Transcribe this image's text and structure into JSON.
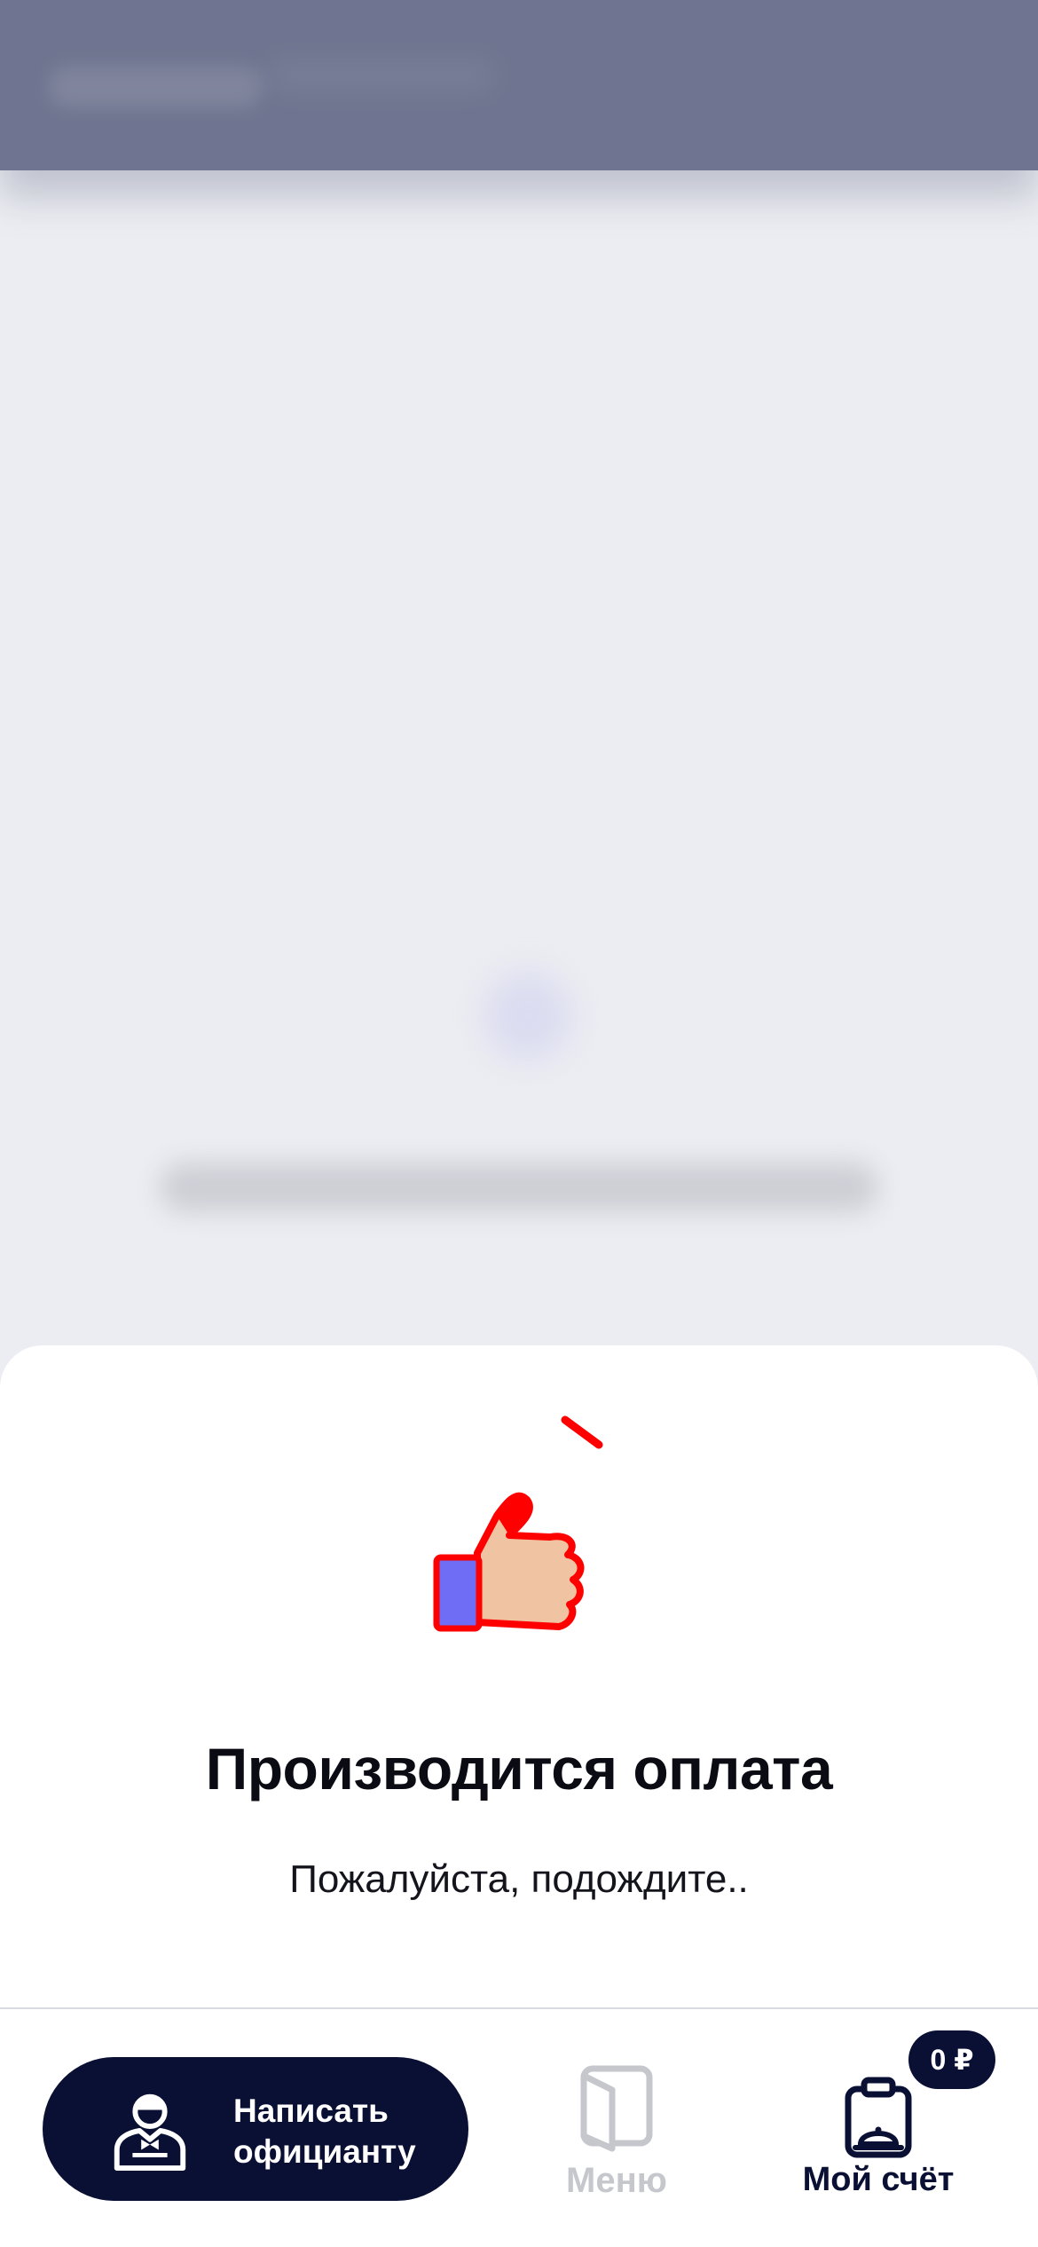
{
  "sheet": {
    "title": "Производится оплата",
    "subtitle": "Пожалуйста, подождите.."
  },
  "bottom_bar": {
    "waiter_button_label": "Написать\nофицианту",
    "menu_label": "Меню",
    "bill_label": "Мой счёт",
    "bill_badge": "0 ₽"
  },
  "icons": {
    "waiter": "waiter-icon",
    "menu": "menu-book-icon",
    "bill": "clipboard-cloche-icon",
    "illustration": "thumbs-up-hand"
  },
  "colors": {
    "accent": "#0a1034",
    "inactive": "#c6c7cd",
    "illustration_red": "#ff0000",
    "illustration_skin": "#f0c4a3",
    "illustration_cuff": "#6f6cf5"
  }
}
